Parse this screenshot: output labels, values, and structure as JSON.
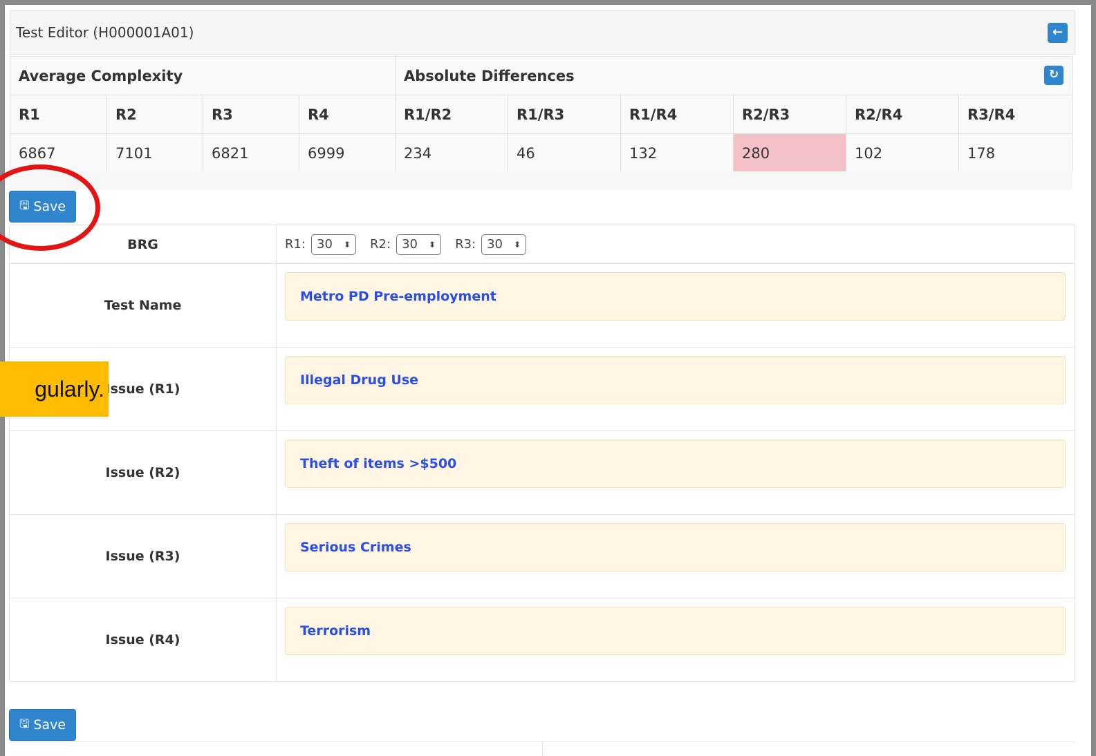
{
  "panel": {
    "title": "Test Editor (H000001A01)",
    "back_icon": "←"
  },
  "stats": {
    "group_avg": "Average Complexity",
    "group_diff": "Absolute Differences",
    "refresh_icon": "↻",
    "headers": [
      "R1",
      "R2",
      "R3",
      "R4",
      "R1/R2",
      "R1/R3",
      "R1/R4",
      "R2/R3",
      "R2/R4",
      "R3/R4"
    ],
    "values": [
      "6867",
      "7101",
      "6821",
      "6999",
      "234",
      "46",
      "132",
      "280",
      "102",
      "178"
    ],
    "highlight_color": "#f5c1c8"
  },
  "save": {
    "label": "Save",
    "icon": "🖫"
  },
  "form": {
    "brg": {
      "label": "BRG",
      "r1_label": "R1:",
      "r1_value": "30",
      "r2_label": "R2:",
      "r2_value": "30",
      "r3_label": "R3:",
      "r3_value": "30",
      "arrow": "⬍"
    },
    "fields": [
      {
        "label": "Test Name",
        "value": "Metro PD Pre-employment"
      },
      {
        "label": "Issue (R1)",
        "value": "Illegal Drug Use"
      },
      {
        "label": "Issue (R2)",
        "value": "Theft of items >$500"
      },
      {
        "label": "Issue (R3)",
        "value": "Serious Crimes"
      },
      {
        "label": "Issue (R4)",
        "value": "Terrorism"
      }
    ]
  },
  "callout": {
    "text": "gularly."
  },
  "colors": {
    "primary": "#2f86cf",
    "field_bg": "#fef5e3",
    "field_text": "#2a4fe8",
    "callout_bg": "#fdbc00",
    "annotation_circle": "#e31414"
  }
}
